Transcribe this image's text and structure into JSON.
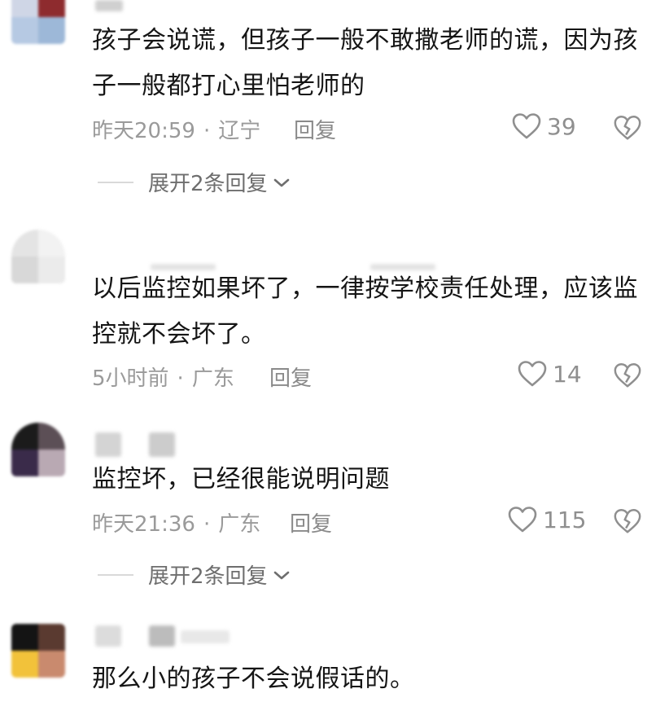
{
  "comments": [
    {
      "text": "孩子会说谎，但孩子一般不敢撒老师的谎，因为孩子一般都打心里怕老师的",
      "time": "昨天20:59",
      "location": "辽宁",
      "reply_label": "回复",
      "likes": "39",
      "expand_label": "展开2条回复"
    },
    {
      "text": "以后监控如果坏了，一律按学校责任处理，应该监控就不会坏了。",
      "time": "5小时前",
      "location": "广东",
      "reply_label": "回复",
      "likes": "14"
    },
    {
      "text": "监控坏，已经很能说明问题",
      "time": "昨天21:36",
      "location": "广东",
      "reply_label": "回复",
      "likes": "115",
      "expand_label": "展开2条回复"
    },
    {
      "text": "那么小的孩子不会说假话的。"
    }
  ],
  "separator": "·",
  "icons": {
    "like": "heart-outline-icon",
    "dislike": "broken-heart-icon",
    "expand": "chevron-down-icon"
  },
  "colors": {
    "text": "#151515",
    "meta": "#9a9a9a",
    "icon": "#8f8f8f"
  }
}
